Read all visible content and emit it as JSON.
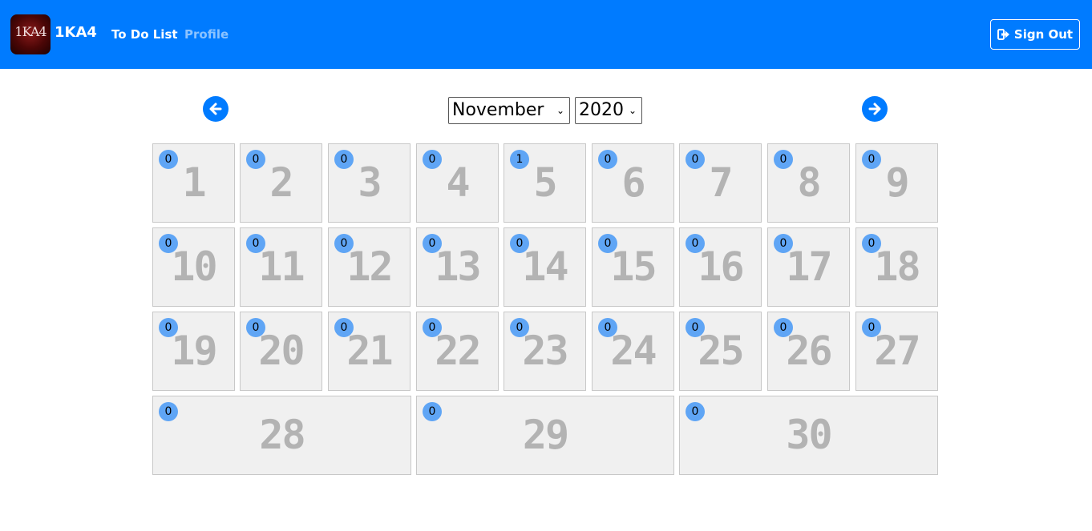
{
  "navbar": {
    "logo_text": "1KA4",
    "brand": "1KA4",
    "links": {
      "todo": "To Do List",
      "profile": "Profile"
    },
    "signout_label": "Sign Out",
    "color": "#007bff"
  },
  "calendar": {
    "month": "November",
    "year": "2020",
    "days": [
      {
        "label": "1",
        "count": "0"
      },
      {
        "label": "2",
        "count": "0"
      },
      {
        "label": "3",
        "count": "0"
      },
      {
        "label": "4",
        "count": "0"
      },
      {
        "label": "5",
        "count": "1"
      },
      {
        "label": "6",
        "count": "0"
      },
      {
        "label": "7",
        "count": "0"
      },
      {
        "label": "8",
        "count": "0"
      },
      {
        "label": "9",
        "count": "0"
      },
      {
        "label": "10",
        "count": "0"
      },
      {
        "label": "11",
        "count": "0"
      },
      {
        "label": "12",
        "count": "0"
      },
      {
        "label": "13",
        "count": "0"
      },
      {
        "label": "14",
        "count": "0"
      },
      {
        "label": "15",
        "count": "0"
      },
      {
        "label": "16",
        "count": "0"
      },
      {
        "label": "17",
        "count": "0"
      },
      {
        "label": "18",
        "count": "0"
      },
      {
        "label": "19",
        "count": "0"
      },
      {
        "label": "20",
        "count": "0"
      },
      {
        "label": "21",
        "count": "0"
      },
      {
        "label": "22",
        "count": "0"
      },
      {
        "label": "23",
        "count": "0"
      },
      {
        "label": "24",
        "count": "0"
      },
      {
        "label": "25",
        "count": "0"
      },
      {
        "label": "26",
        "count": "0"
      },
      {
        "label": "27",
        "count": "0"
      },
      {
        "label": "28",
        "count": "0"
      },
      {
        "label": "29",
        "count": "0"
      },
      {
        "label": "30",
        "count": "0"
      }
    ]
  }
}
